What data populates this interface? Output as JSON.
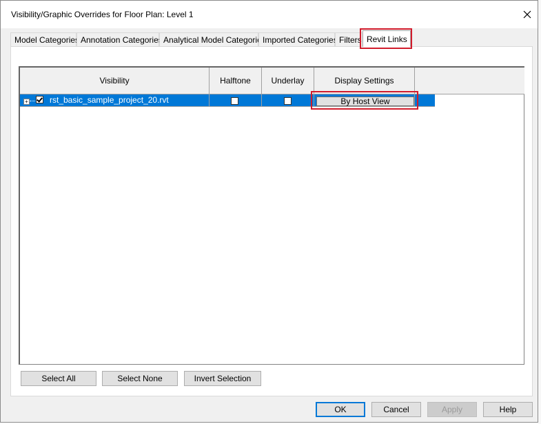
{
  "window": {
    "title": "Visibility/Graphic Overrides for Floor Plan: Level 1",
    "close_icon": "close-icon"
  },
  "tabs": [
    {
      "label": "Model Categories",
      "active": false
    },
    {
      "label": "Annotation Categories",
      "active": false
    },
    {
      "label": "Analytical Model Categories",
      "active": false
    },
    {
      "label": "Imported Categories",
      "active": false
    },
    {
      "label": "Filters",
      "active": false
    },
    {
      "label": "Revit Links",
      "active": true
    }
  ],
  "grid": {
    "columns": [
      "Visibility",
      "Halftone",
      "Underlay",
      "Display Settings"
    ],
    "rows": [
      {
        "expanded": false,
        "visible": true,
        "name": "rst_basic_sample_project_20.rvt",
        "halftone": false,
        "underlay": false,
        "display_settings": "By Host View",
        "selected": true
      }
    ]
  },
  "selection_buttons": {
    "select_all": "Select All",
    "select_none": "Select None",
    "invert_selection": "Invert Selection"
  },
  "footer_buttons": {
    "ok": "OK",
    "cancel": "Cancel",
    "apply": "Apply",
    "help": "Help"
  },
  "colors": {
    "selection": "#0078d7",
    "highlight_box": "#d11b2b",
    "dialog_bg": "#f0f0f0"
  }
}
